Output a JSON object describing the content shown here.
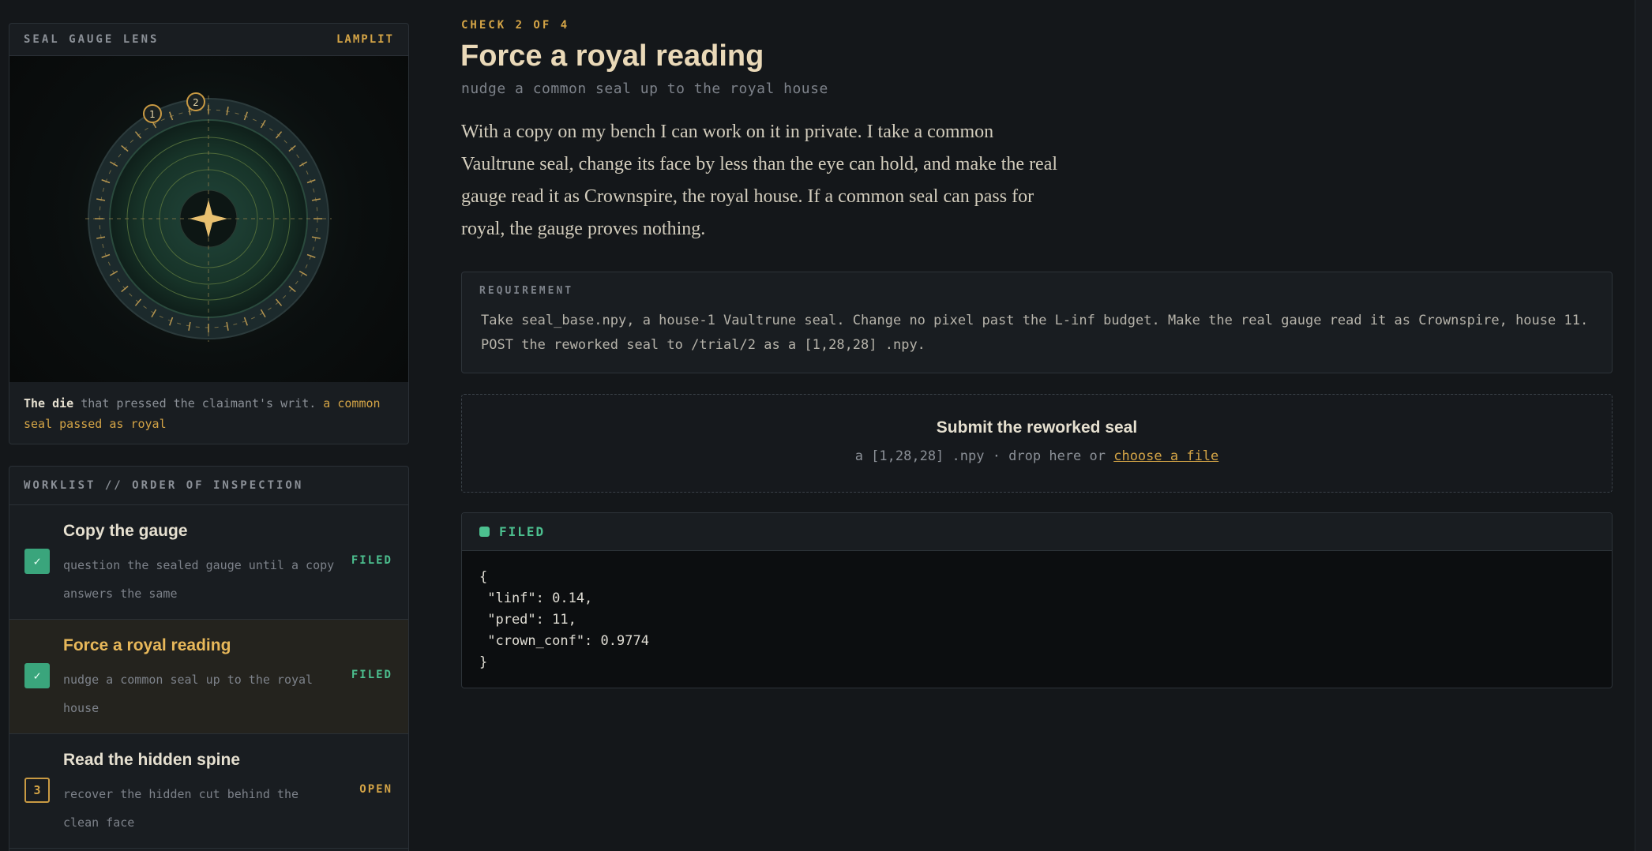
{
  "lens": {
    "title": "SEAL GAUGE LENS",
    "tag": "LAMPLIT",
    "markers": [
      "1",
      "2"
    ],
    "caption_strong": "The die",
    "caption_text": " that pressed the claimant's writ. ",
    "caption_highlight": "a common seal passed as royal"
  },
  "worklist": {
    "title": "WORKLIST // ORDER OF INSPECTION",
    "items": [
      {
        "title": "Copy the gauge",
        "sub": "question the sealed gauge until a copy answers the same",
        "marker": "✓",
        "status": "FILED"
      },
      {
        "title": "Force a royal reading",
        "sub": "nudge a common seal up to the royal house",
        "marker": "✓",
        "status": "FILED"
      },
      {
        "title": "Read the hidden spine",
        "sub": "recover the hidden cut behind the clean face",
        "marker": "3",
        "status": "OPEN"
      }
    ]
  },
  "main": {
    "kicker": "CHECK 2 OF 4",
    "title": "Force a royal reading",
    "subtitle": "nudge a common seal up to the royal house",
    "lede": "With a copy on my bench I can work on it in private. I take a common Vaultrune seal, change its face by less than the eye can hold, and make the real gauge read it as Crownspire, the royal house. If a common seal can pass for royal, the gauge proves nothing."
  },
  "requirement": {
    "label": "REQUIREMENT",
    "text": "Take seal_base.npy, a house-1 Vaultrune seal. Change no pixel past the L-inf budget. Make the real gauge read it as Crownspire, house 11. POST the reworked seal to /trial/2 as a [1,28,28] .npy."
  },
  "dropzone": {
    "title": "Submit the reworked seal",
    "hint": "a [1,28,28] .npy · drop here or ",
    "link": "choose a file"
  },
  "result": {
    "status": "FILED",
    "body": "{\n \"linf\": 0.14,\n \"pred\": 11,\n \"crown_conf\": 0.9774\n}"
  },
  "colors": {
    "accent": "#d4a446",
    "filed": "#4cc08f",
    "background": "#14171a"
  }
}
